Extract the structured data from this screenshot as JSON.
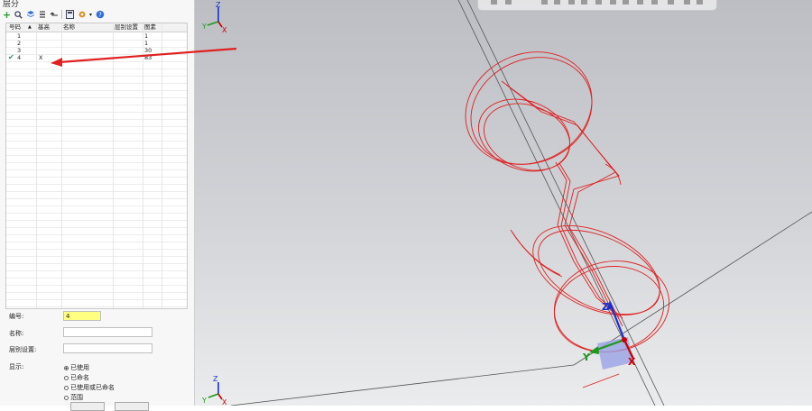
{
  "panel": {
    "title": "层分",
    "toolbar_icons": [
      "add-icon",
      "search-icon",
      "layers-icon",
      "layer-stack-icon",
      "arrow-back-icon",
      "calculator-icon",
      "gear-icon",
      "help-icon"
    ],
    "grid": {
      "headers": [
        "号码",
        "基高",
        "名称",
        "层别设置",
        "图素"
      ],
      "rows": [
        {
          "num": "1",
          "base": "",
          "name": "",
          "setting": "",
          "count": "1",
          "active": false
        },
        {
          "num": "2",
          "base": "",
          "name": "",
          "setting": "",
          "count": "1",
          "active": false
        },
        {
          "num": "3",
          "base": "",
          "name": "",
          "setting": "",
          "count": "30",
          "active": false
        },
        {
          "num": "4",
          "base": "X",
          "name": "",
          "setting": "",
          "count": "83",
          "active": true
        }
      ]
    },
    "form": {
      "number_label": "编号:",
      "number_value": "4",
      "name_label": "名称:",
      "name_value": "",
      "layer_setting_label": "层别设置:",
      "layer_setting_value": "",
      "display_label": "显示:",
      "display_options": [
        {
          "label": "已使用",
          "selected": true
        },
        {
          "label": "已命名",
          "selected": false
        },
        {
          "label": "已使用或已命名",
          "selected": false
        },
        {
          "label": "范围",
          "selected": false
        }
      ]
    }
  },
  "viewport": {
    "triad_top_labels": {
      "z": "Z",
      "y": "Y",
      "x": "X"
    },
    "triad_bottom_labels": {
      "z": "Z",
      "y": "Y",
      "x": "X"
    },
    "part_gnomon_labels": {
      "z": "Z",
      "y": "Y",
      "x": "X"
    },
    "colors": {
      "geometry": "#e02020",
      "annotation_arrow": "#e02020",
      "axis_x": "#cc0000",
      "axis_y": "#1a9a1a",
      "axis_z": "#1a2fd0",
      "number_highlight": "#ffff80"
    }
  }
}
